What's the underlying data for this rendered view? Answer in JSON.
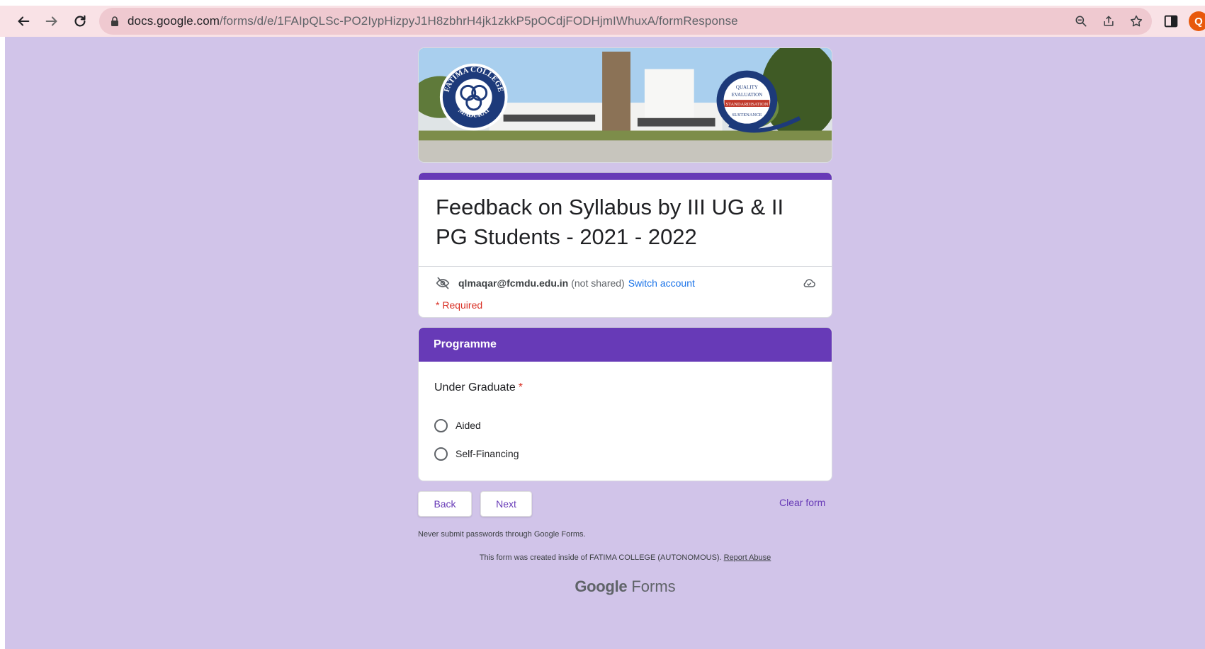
{
  "browser": {
    "url_host": "docs.google.com",
    "url_path": "/forms/d/e/1FAIpQLSc-PO2IypHizpyJ1H8zbhrH4jk1zkkP5pOCdjFODHjmIWhuxA/formResponse",
    "profile_initial": "Q",
    "chrome_color": "#f9e2e6",
    "omnibox_color": "#efc9d0"
  },
  "theme": {
    "page_background": "#d1c4e9",
    "accent": "#673ab7",
    "required_color": "#d93025",
    "link_color": "#1a73e8"
  },
  "banner": {
    "left_logo_top": "FATIMA COLLEGE",
    "left_logo_bottom": "MADURAI",
    "right_logo_lines": [
      "QUALITY",
      "EVALUATION",
      "STANDARDISATION",
      "SUSTENANCE"
    ]
  },
  "form": {
    "title": "Feedback on Syllabus by III UG & II PG Students - 2021 - 2022",
    "account_email": "qlmaqar@fcmdu.edu.in",
    "not_shared": "(not shared)",
    "switch_account": "Switch account",
    "required_note": "* Required"
  },
  "section": {
    "title": "Programme",
    "question": "Under Graduate",
    "required_mark": "*",
    "options": [
      "Aided",
      "Self-Financing"
    ]
  },
  "buttons": {
    "back": "Back",
    "next": "Next",
    "clear": "Clear form"
  },
  "footer": {
    "password_note": "Never submit passwords through Google Forms.",
    "created_note": "This form was created inside of FATIMA COLLEGE (AUTONOMOUS).",
    "report_abuse": "Report Abuse",
    "logo_google": "Google",
    "logo_forms": "Forms"
  }
}
